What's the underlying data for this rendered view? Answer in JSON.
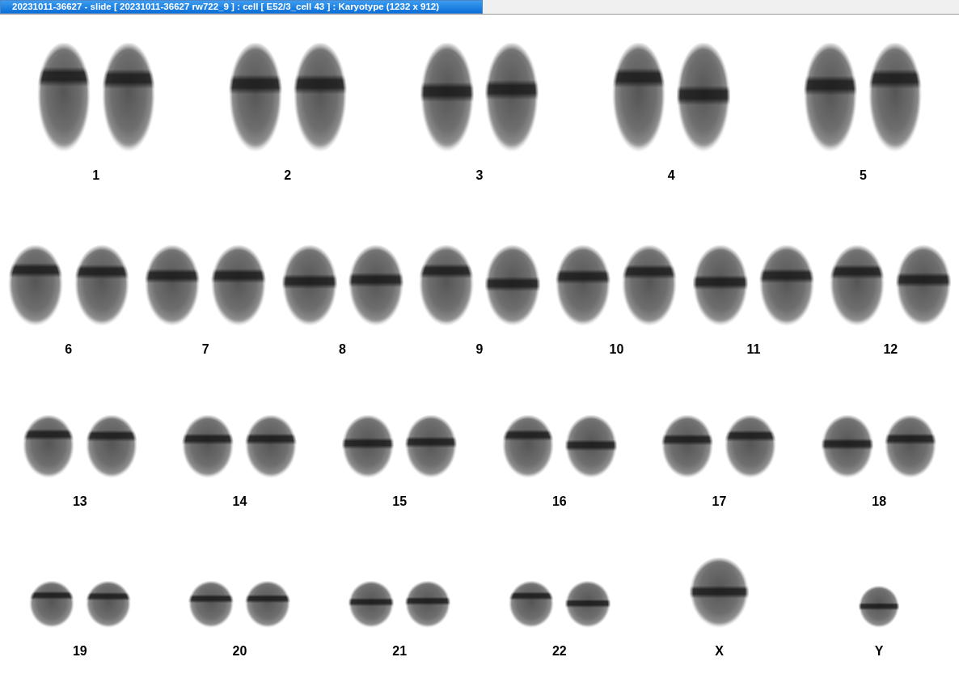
{
  "window": {
    "title": "20231011-36627 - slide [ 20231011-36627 rw722_9 ] : cell [ E52/3_cell 43 ] : Karyotype  (1232 x 912)"
  },
  "karyotype": {
    "rows": [
      {
        "groups": [
          {
            "label": "1",
            "kind": "pair"
          },
          {
            "label": "2",
            "kind": "pair"
          },
          {
            "label": "3",
            "kind": "pair"
          },
          {
            "label": "4",
            "kind": "pair"
          },
          {
            "label": "5",
            "kind": "pair"
          }
        ]
      },
      {
        "groups": [
          {
            "label": "6",
            "kind": "pair"
          },
          {
            "label": "7",
            "kind": "pair"
          },
          {
            "label": "8",
            "kind": "pair"
          },
          {
            "label": "9",
            "kind": "pair"
          },
          {
            "label": "10",
            "kind": "pair"
          },
          {
            "label": "11",
            "kind": "pair"
          },
          {
            "label": "12",
            "kind": "pair"
          }
        ]
      },
      {
        "groups": [
          {
            "label": "13",
            "kind": "pair"
          },
          {
            "label": "14",
            "kind": "pair"
          },
          {
            "label": "15",
            "kind": "pair"
          },
          {
            "label": "16",
            "kind": "pair"
          },
          {
            "label": "17",
            "kind": "pair"
          },
          {
            "label": "18",
            "kind": "pair"
          }
        ]
      },
      {
        "groups": [
          {
            "label": "19",
            "kind": "pair"
          },
          {
            "label": "20",
            "kind": "pair"
          },
          {
            "label": "21",
            "kind": "pair"
          },
          {
            "label": "22",
            "kind": "pair"
          },
          {
            "label": "X",
            "kind": "single"
          },
          {
            "label": "Y",
            "kind": "single"
          }
        ]
      }
    ]
  }
}
